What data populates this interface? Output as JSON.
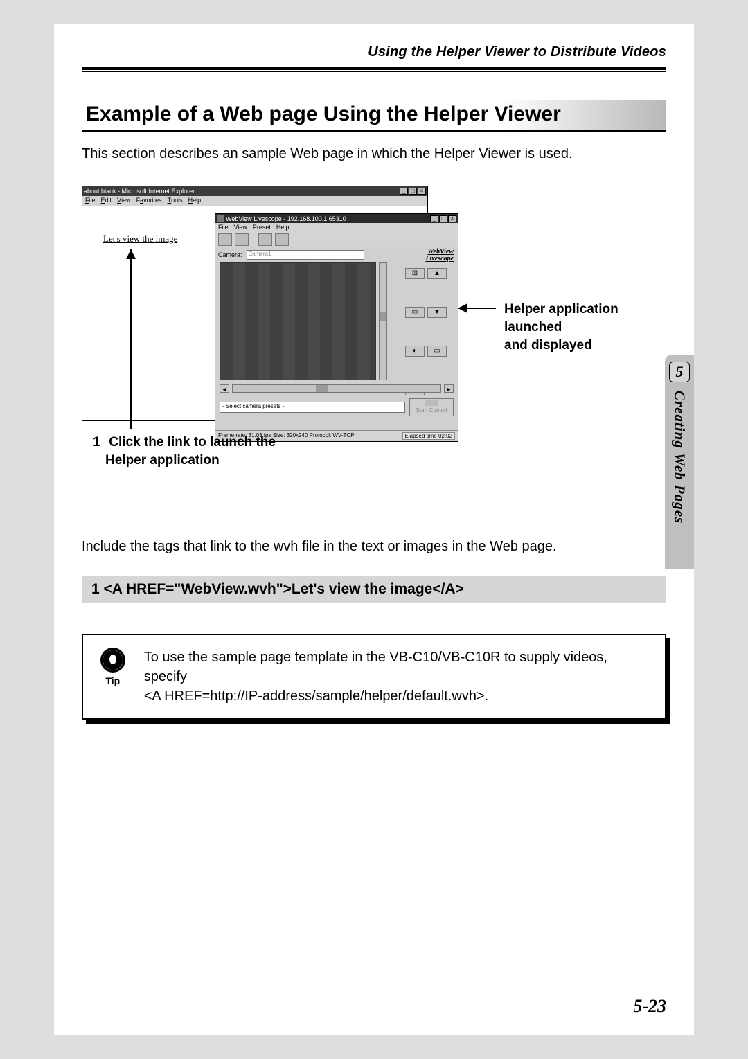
{
  "header": {
    "running_head": "Using the Helper Viewer to Distribute Videos"
  },
  "section": {
    "title": "Example of a Web page Using the Helper Viewer",
    "intro": "This section describes an sample Web page in which the Helper Viewer is used."
  },
  "figure": {
    "ie": {
      "title": "about:blank - Microsoft Internet Explorer",
      "menu": [
        "File",
        "Edit",
        "View",
        "Favorites",
        "Tools",
        "Help"
      ],
      "link_text": "Let's view the image"
    },
    "helper": {
      "title": "WebView Livescope - 192.168.100.1:65310",
      "menu": [
        "File",
        "View",
        "Preset",
        "Help"
      ],
      "camera_label": "Camera:",
      "camera_value": "Camera1",
      "brand_line1": "WebView",
      "brand_line2": "Livescope",
      "preset_label": "- Select camera presets -",
      "start_label": "Start Control",
      "status": "Frame rate: 31.03 fps   Size: 320x240   Protocol: WV-TCP",
      "elapsed": "Elapsed time 02:02"
    },
    "callout_right_line1": "Helper application launched",
    "callout_right_line2": "and displayed",
    "callout_bottom_num": "1",
    "callout_bottom_line1": "Click the link to launch the",
    "callout_bottom_line2": "Helper application"
  },
  "para2": "Include the tags that link to the wvh file in the text or images in the Web page.",
  "code_bar": "1   <A HREF=\"WebView.wvh\">Let's view the image</A>",
  "tip": {
    "label": "Tip",
    "text_line1": "To use the sample page template in the VB-C10/VB-C10R to supply videos, specify",
    "text_line2": "<A HREF=http://IP-address/sample/helper/default.wvh>."
  },
  "side_tab": {
    "chapter_number": "5",
    "chapter_title": "Creating Web Pages"
  },
  "page_number": "5-23"
}
